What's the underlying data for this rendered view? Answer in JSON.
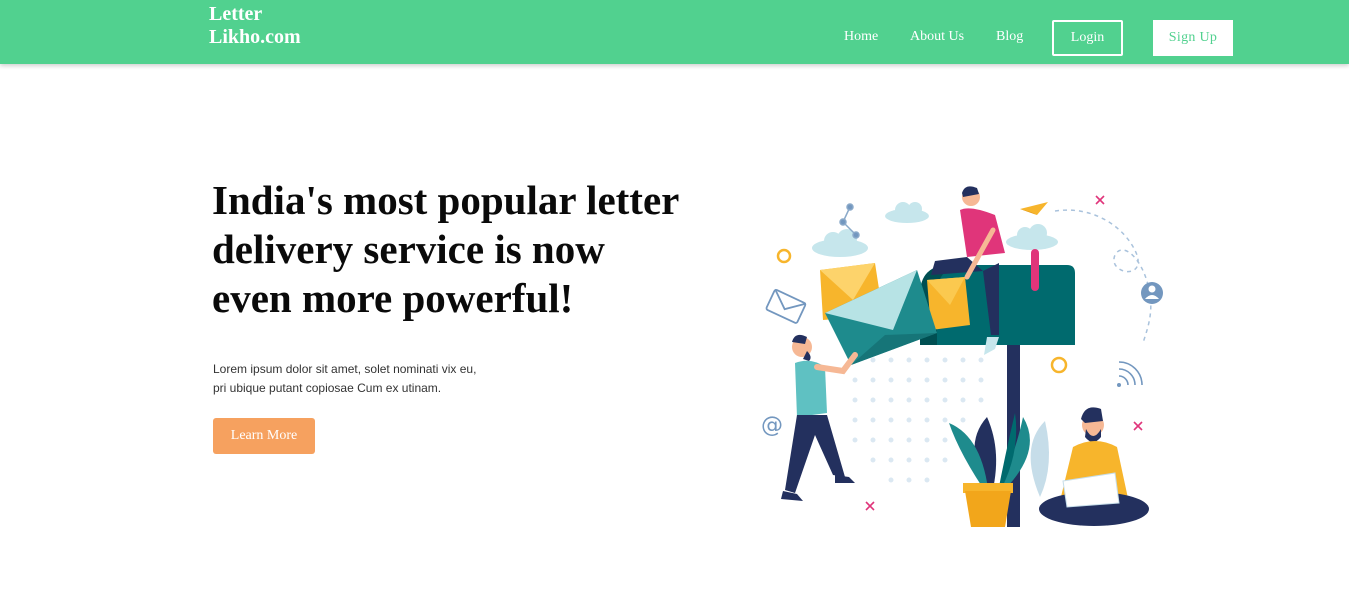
{
  "nav": {
    "brand_line1": "Letter",
    "brand_line2": "Likho.com",
    "links": [
      "Home",
      "About Us",
      "Blog"
    ],
    "login_label": "Login",
    "signup_label": "Sign Up"
  },
  "hero": {
    "title_line1": "India's most popular letter",
    "title_line2": "delivery service is now",
    "title_line3": "even more powerful!",
    "text_line1": "Lorem ipsum dolor sit amet, solet nominati vix eu,",
    "text_line2": "pri ubique putant copiosae Cum ex utinam.",
    "cta_label": "Learn More"
  },
  "colors": {
    "nav_bg": "#51d18f",
    "cta_bg": "#f6a15f",
    "mailbox": "#006a6e",
    "accent_pink": "#e0357a",
    "accent_yellow": "#f7b52c"
  },
  "icons": [
    "envelope-icon",
    "at-sign-icon",
    "user-icon",
    "wifi-icon",
    "paper-plane-icon",
    "share-icon",
    "close-icon"
  ]
}
